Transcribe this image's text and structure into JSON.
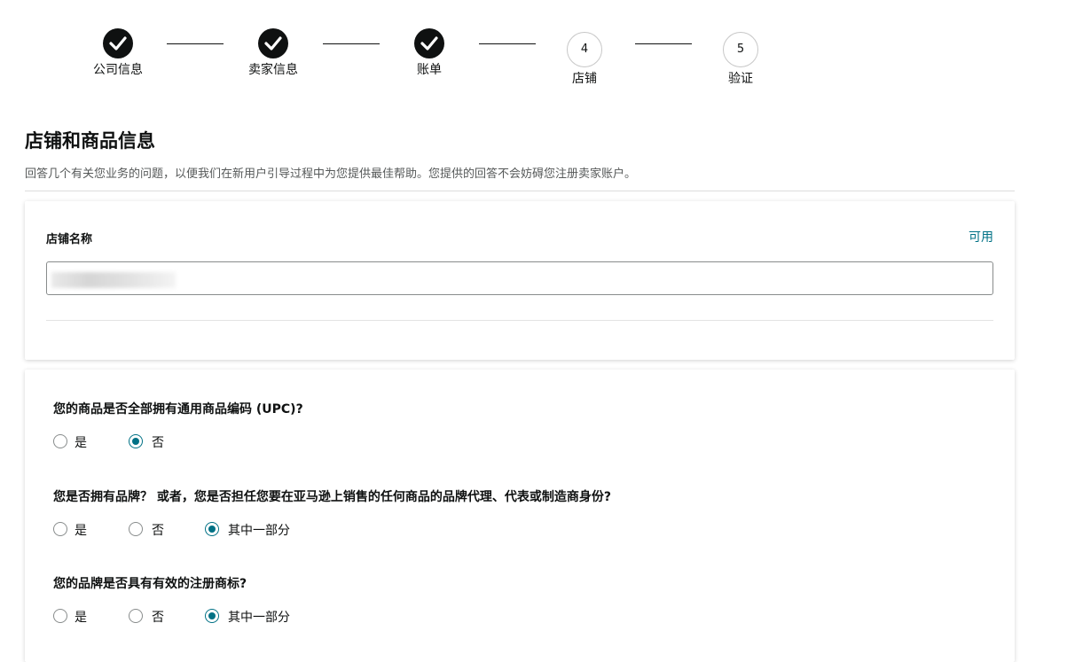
{
  "stepper": {
    "steps": [
      {
        "label": "公司信息",
        "state": "done",
        "icon": "check-icon"
      },
      {
        "label": "卖家信息",
        "state": "done",
        "icon": "check-icon"
      },
      {
        "label": "账单",
        "state": "done",
        "icon": "check-icon"
      },
      {
        "label": "店铺",
        "state": "current",
        "number": "4"
      },
      {
        "label": "验证",
        "state": "todo",
        "number": "5"
      }
    ]
  },
  "page": {
    "title": "店铺和商品信息",
    "subtitle": "回答几个有关您业务的问题，以便我们在新用户引导过程中为您提供最佳帮助。您提供的回答不会妨碍您注册卖家账户。"
  },
  "store": {
    "label": "店铺名称",
    "availability": "可用",
    "value": ""
  },
  "questions": [
    {
      "text": "您的商品是否全部拥有通用商品编码 (UPC)?",
      "options": [
        "是",
        "否"
      ],
      "selected": 1
    },
    {
      "text": "您是否拥有品牌？ 或者，您是否担任您要在亚马逊上销售的任何商品的品牌代理、代表或制造商身份?",
      "options": [
        "是",
        "否",
        "其中一部分"
      ],
      "selected": 2
    },
    {
      "text": "您的品牌是否具有有效的注册商标?",
      "options": [
        "是",
        "否",
        "其中一部分"
      ],
      "selected": 2
    }
  ],
  "colors": {
    "accent": "#007185",
    "text": "#0f1111",
    "muted": "#565959"
  }
}
